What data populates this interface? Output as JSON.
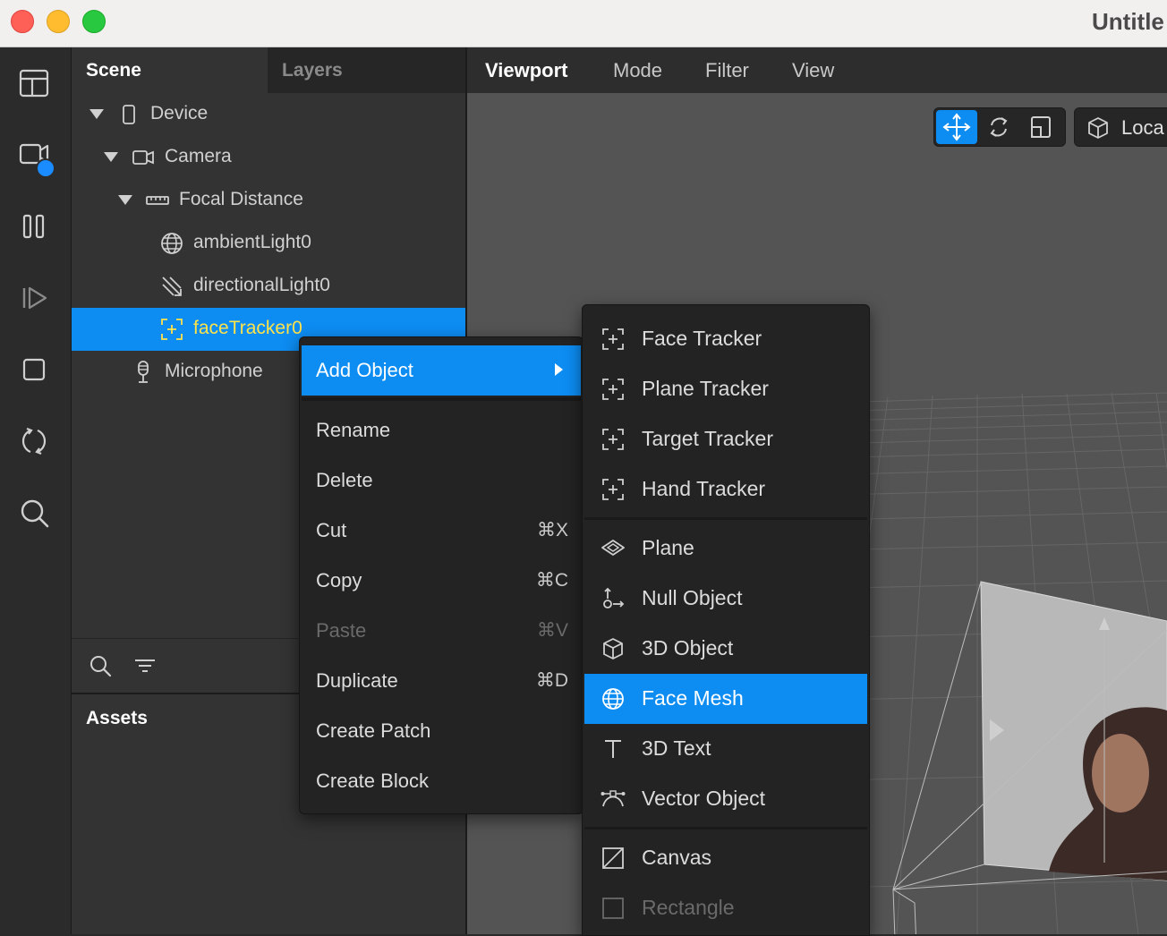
{
  "window": {
    "title": "Untitle"
  },
  "left_toolbar": {
    "tools": [
      "layout-icon",
      "video-camera-icon",
      "pause-icon",
      "play-icon",
      "square-icon",
      "sync-icon",
      "search-icon"
    ]
  },
  "scene_panel": {
    "tabs": {
      "scene": "Scene",
      "layers": "Layers"
    },
    "tree": [
      {
        "label": "Device",
        "icon": "device-icon"
      },
      {
        "label": "Camera",
        "icon": "camera-icon"
      },
      {
        "label": "Focal Distance",
        "icon": "ruler-icon"
      },
      {
        "label": "ambientLight0",
        "icon": "globe-icon"
      },
      {
        "label": "directionalLight0",
        "icon": "directional-light-icon"
      },
      {
        "label": "faceTracker0",
        "icon": "face-tracker-icon",
        "selected": true
      },
      {
        "label": "Microphone",
        "icon": "microphone-icon"
      }
    ],
    "assets_title": "Assets"
  },
  "viewport": {
    "tabs": {
      "viewport": "Viewport",
      "mode": "Mode",
      "filter": "Filter",
      "view": "View"
    },
    "local_label": "Loca"
  },
  "context_menu": {
    "add_object": "Add Object",
    "rename": "Rename",
    "delete": "Delete",
    "cut": "Cut",
    "cut_shortcut": "⌘X",
    "copy": "Copy",
    "copy_shortcut": "⌘C",
    "paste": "Paste",
    "paste_shortcut": "⌘V",
    "duplicate": "Duplicate",
    "duplicate_shortcut": "⌘D",
    "create_patch": "Create Patch",
    "create_block": "Create Block"
  },
  "add_object_menu": {
    "face_tracker": "Face Tracker",
    "plane_tracker": "Plane Tracker",
    "target_tracker": "Target Tracker",
    "hand_tracker": "Hand Tracker",
    "plane": "Plane",
    "null_object": "Null Object",
    "object_3d": "3D Object",
    "face_mesh": "Face Mesh",
    "text_3d": "3D Text",
    "vector_object": "Vector Object",
    "canvas": "Canvas",
    "rectangle": "Rectangle"
  },
  "colors": {
    "accent": "#0d8cf2",
    "selected_text": "#ffe34a",
    "panel": "#333333",
    "menu": "#232323"
  }
}
